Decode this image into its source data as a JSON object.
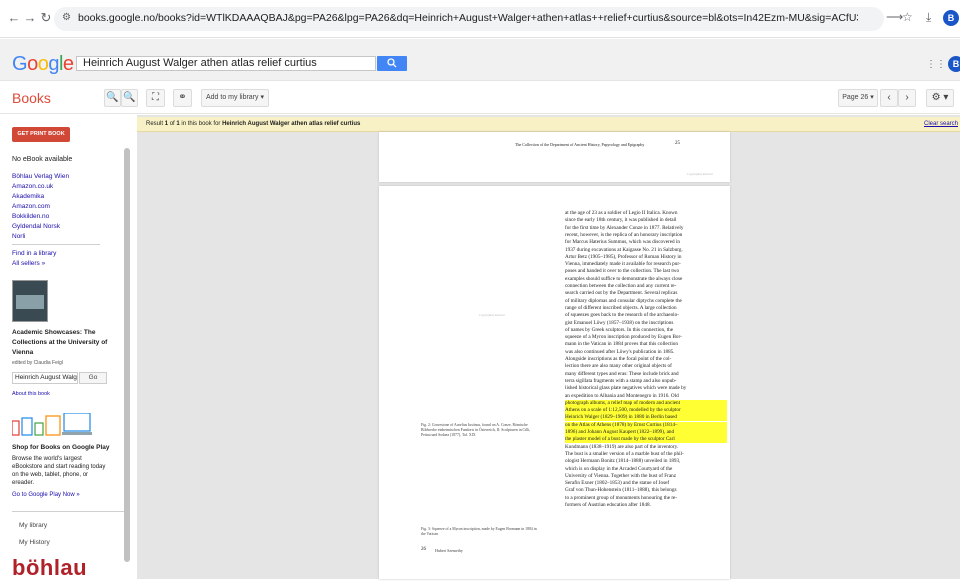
{
  "browser": {
    "url": "books.google.no/books?id=WTlKDAAAQBAJ&pg=PA26&lpg=PA26&dq=Heinrich+August+Walger+athen+atlas++relief+curtius&source=bl&ots=In42Ezm-MU&sig=ACfU3U0p0Z0kBSr8t9-TgDmTZhEVUMMFeQ&hl=en&sa=X&ved=2ahUKEwjPp5u7zPa...",
    "profile_letter": "B"
  },
  "google": {
    "logo": "Google",
    "logo_colors": [
      "#4285f4",
      "#ea4335",
      "#fbbc05",
      "#4285f4",
      "#34a853",
      "#ea4335"
    ],
    "search_value": "Heinrich August Walger athen atlas  relief curtius",
    "profile_letter": "B"
  },
  "toolbar": {
    "section": "Books",
    "add_library": "Add to my library",
    "page_select": "Page 26"
  },
  "sidebar": {
    "print_button": "GET PRINT BOOK",
    "no_ebook": "No eBook available",
    "sellers": [
      "Böhlau Verlag Wien",
      "Amazon.co.uk",
      "Akademika",
      "Amazon.com",
      "Bokkilden.no",
      "Gyldendal Norsk",
      "Norli"
    ],
    "find_library": "Find in a library",
    "all_sellers": "All sellers »",
    "book_title_1": "Academic Showcases: The",
    "book_title_2": "Collections at the University of",
    "book_title_3": "Vienna",
    "editor": "edited by Claudia Feigl",
    "inbook_search": "Heinrich August Walg",
    "go": "Go",
    "about": "About this book",
    "shop_title": "Shop for Books on Google Play",
    "shop_desc_1": "Browse the world's largest",
    "shop_desc_2": "eBookstore and start reading today",
    "shop_desc_3": "on the web, tablet, phone, or",
    "shop_desc_4": "ereader.",
    "play_link": "Go to Google Play Now »",
    "my_library": "My library",
    "my_history": "My History",
    "publisher_logo": "böhlau"
  },
  "result_bar": {
    "prefix": "Result ",
    "n": "1",
    "of": " of ",
    "total": "1",
    "mid": " in this book for ",
    "query": "Heinrich August Walger athen atlas relief curtius",
    "clear": "Clear search"
  },
  "page_top": {
    "running_head": "The Collection of the Department of Ancient History, Papyrology and Epigraphy",
    "page_no": "25",
    "copyright": "Copyrighted material"
  },
  "page_main": {
    "lines": [
      "at the age of 23 as a soldier of Legio II Italica. Known",
      "since the early 18th century, it was published in detail",
      "for the first time by Alexander Conze in 1877. Relatively",
      "recent, however, is the replica of an honorary inscription",
      "for Marcus Haterius Summus, which was discovered in",
      "1937 during excavations at Kaigasse No. 21 in Salzburg.",
      "Artur Betz (1905–1985), Professor of Roman History in",
      "Vienna, immediately made it available for research pur-",
      "poses and handed it over to the collection. The last two",
      "examples should suffice to demonstrate the always close",
      "connection between the collection and any current re-",
      "search carried out by the Department. Several replicas",
      "of military diplomas and consular diptychs complete the",
      "range of different inscribed objects. A large collection",
      "of squeezes goes back to the research of the archaeolo-",
      "gist Emanuel Löwy (1857–1938) on the inscriptions",
      "of names by Greek sculptors. In this connection, the",
      "squeeze of a Myron inscription produced by Eugen Bor-",
      "mann in the Vatican in 1884 proves that this collection",
      "was also continued after Löwy's publication in 1885.",
      "   Alongside inscriptions as the focal point of the col-",
      "lection there are also many other original objects of",
      "many different types and eras: These include brick and",
      "terra sigillata fragments with a stamp and also unpub-",
      "lished historical glass plate negatives which were made by",
      "an expedition to Albania and Montenegro in 1916. Old",
      "photograph albums, a relief map of modern and ancient",
      "Athens on a scale of 1:12,500, modelled by the sculptor",
      "Heinrich Walger (1829–1909) in 1880 in Berlin based",
      "on the Atlas of Athens (1878) by Ernst Curtius (1814–",
      "1896) and Johann August Kaupert (1822–1899), and",
      "the plaster model of a bust made by the sculptor Carl",
      "Kundmann (1838–1919) are also part of the inventory.",
      "The bust is a smaller version of a marble bust of the phil-",
      "ologist Hermann Bonitz (1814–1888) unveiled in 1893,",
      "which is on display in the Arcaded Courtyard of the",
      "University of Vienna. Together with the bust of Franz",
      "Serafin Exner (1802–1853) and the statue of Josef",
      "Graf von Thun-Hohenstein (1811–1888), this belongs",
      "to a prominent group of monuments honouring the re-",
      "formers of Austrian education after 1848."
    ],
    "caption_1a": "Fig. 2: Gravestone of Aurelius Iustinus, found on A. Conze, Römische",
    "caption_1b": "Bildwerke einheimischen Fundorts in Österreich, II: Sculpturen in Cilli,",
    "caption_1c": "Pettau und Sodaea (1877), Taf. XIX",
    "caption_2a": "Fig. 3: Squeeze of a Myron inscription, made by Eugen Bormann in 1884 in",
    "caption_2b": "the Vatican",
    "page_no": "26",
    "author": "Hubert Szemethy",
    "placeholder": "Copyrighted material"
  }
}
